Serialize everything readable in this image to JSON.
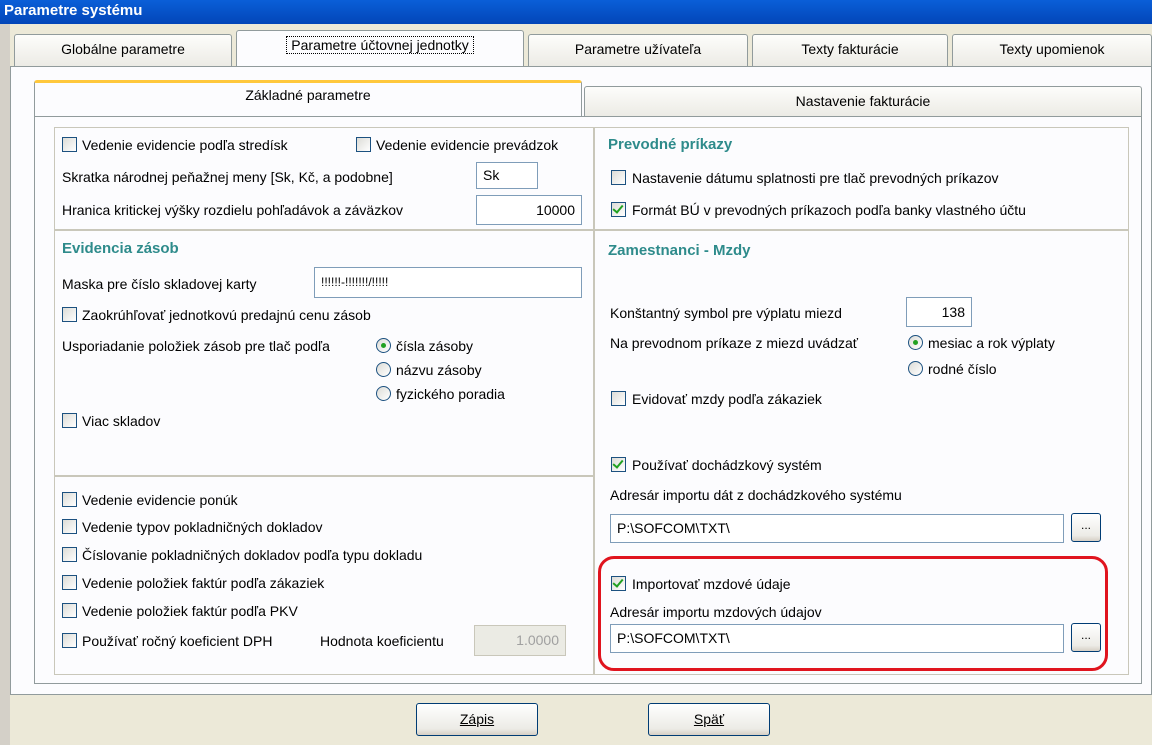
{
  "window": {
    "title": "Parametre systému"
  },
  "outer_tabs": [
    {
      "label": "Globálne parametre"
    },
    {
      "label": "Parametre účtovnej jednotky"
    },
    {
      "label": "Parametre užívateľa"
    },
    {
      "label": "Texty fakturácie"
    },
    {
      "label": "Texty upomienok"
    }
  ],
  "inner_tabs": [
    {
      "label": "Základné parametre"
    },
    {
      "label": "Nastavenie fakturácie"
    }
  ],
  "top_left": {
    "cb_strediska": "Vedenie evidencie podľa stredísk",
    "cb_prevadzok": "Vedenie evidencie prevádzok",
    "currency_label": "Skratka národnej peňažnej meny [Sk, Kč, a podobne]",
    "currency_value": "Sk",
    "limit_label": "Hranica kritickej výšky rozdielu pohľadávok a záväzkov",
    "limit_value": "10000"
  },
  "prevodne": {
    "title": "Prevodné príkazy",
    "cb_datum": "Nastavenie dátumu splatnosti pre tlač prevodných príkazov",
    "cb_format": "Formát BÚ v prevodných príkazoch podľa banky vlastného účtu"
  },
  "zasoby": {
    "title": "Evidencia zásob",
    "mask_label": "Maska pre číslo skladovej karty",
    "mask_value": "!!!!!!-!!!!!!!/!!!!!",
    "cb_round": "Zaokrúhľovať jednotkovú predajnú cenu zásob",
    "order_label": "Usporiadanie položiek zásob pre tlač podľa",
    "opt_cislo": "čísla zásoby",
    "opt_nazov": "názvu zásoby",
    "opt_fyz": "fyzického poradia",
    "cb_sklady": "Viac skladov"
  },
  "mzdy": {
    "title": "Zamestnanci - Mzdy",
    "ks_label": "Konštantný symbol pre výplatu miezd",
    "ks_value": "138",
    "prikaz_label": "Na prevodnom príkaze z miezd uvádzať",
    "opt_mesiac": "mesiac a rok výplaty",
    "opt_rodne": "rodné číslo",
    "cb_zakazky": "Evidovať mzdy podľa zákaziek",
    "cb_dochadzka": "Používať dochádzkový systém",
    "dir_doch_label": "Adresár importu dát z dochádzkového systému",
    "dir_doch_value": "P:\\SOFCOM\\TXT\\",
    "cb_import": "Importovať mzdové údaje",
    "dir_mzdy_label": "Adresár importu mzdových údajov",
    "dir_mzdy_value": "P:\\SOFCOM\\TXT\\",
    "browse": "..."
  },
  "bottom_left": {
    "cb1": "Vedenie evidencie ponúk",
    "cb2": "Vedenie typov pokladničných dokladov",
    "cb3": "Číslovanie pokladničných dokladov podľa typu dokladu",
    "cb4": "Vedenie položiek faktúr podľa zákaziek",
    "cb5": "Vedenie položiek faktúr podľa PKV",
    "cb6": "Používať ročný koeficient DPH",
    "coef_label": "Hodnota koeficientu",
    "coef_value": "1.0000"
  },
  "buttons": {
    "save": "Zápis",
    "back": "Späť"
  }
}
